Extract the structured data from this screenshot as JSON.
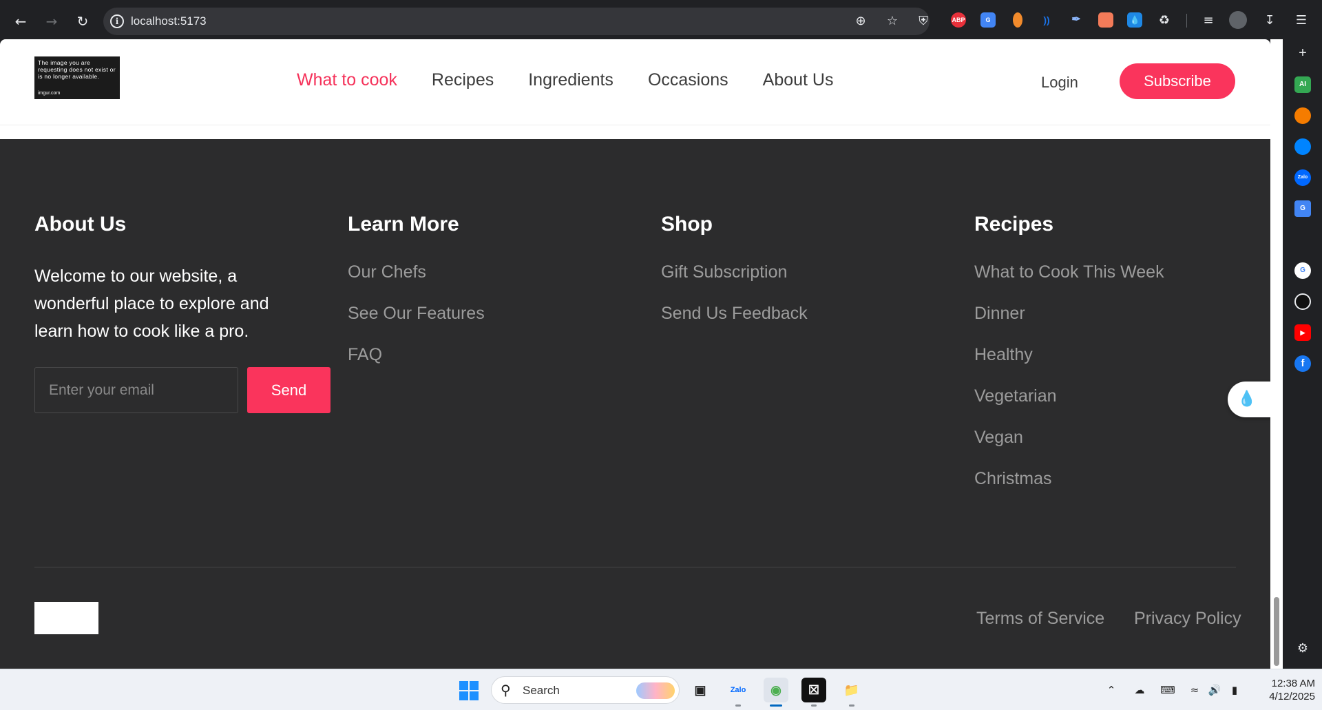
{
  "browser": {
    "url": "localhost:5173",
    "extensions": [
      {
        "name": "adblock-plus-icon",
        "label": "ABP",
        "color": "#e8313b"
      },
      {
        "name": "google-translate-icon",
        "label": "G",
        "color": "#4285f4"
      },
      {
        "name": "extension-orange-icon",
        "label": "",
        "color": "#f28b2c"
      },
      {
        "name": "extension-wave-icon",
        "label": "))",
        "color": "#1a73e8"
      },
      {
        "name": "eyedropper-icon",
        "label": "",
        "color": "#3b3b8f"
      },
      {
        "name": "extension-pattern-icon",
        "label": "",
        "color": "#f37b59"
      },
      {
        "name": "water-drop-icon",
        "label": "",
        "color": "#1e88e5"
      }
    ]
  },
  "header": {
    "logo": {
      "line1": "The image you are requesting does not exist or is no longer available.",
      "line2": "imgur.com"
    },
    "menu": [
      "What to cook",
      "Recipes",
      "Ingredients",
      "Occasions",
      "About Us"
    ],
    "active_menu_index": 0,
    "login": "Login",
    "subscribe": "Subscribe"
  },
  "footer": {
    "about": {
      "title": "About Us",
      "text": "Welcome to our website, a wonderful place to explore and learn how to cook like a pro.",
      "email_placeholder": "Enter your email",
      "send": "Send"
    },
    "learn_more": {
      "title": "Learn More",
      "links": [
        "Our Chefs",
        "See Our Features",
        "FAQ"
      ]
    },
    "shop": {
      "title": "Shop",
      "links": [
        "Gift Subscription",
        "Send Us Feedback"
      ]
    },
    "recipes": {
      "title": "Recipes",
      "links": [
        "What to Cook This Week",
        "Dinner",
        "Healthy",
        "Vegetarian",
        "Vegan",
        "Christmas"
      ]
    },
    "terms": "Terms of Service",
    "privacy": "Privacy Policy"
  },
  "sidepanel": [
    {
      "name": "copilot-ai-icon",
      "label": "AI",
      "color": "#34a853"
    },
    {
      "name": "firefox-like-icon",
      "label": "",
      "color": "#f57c00"
    },
    {
      "name": "messenger-icon",
      "label": "",
      "color": "#0084ff"
    },
    {
      "name": "zalo-icon",
      "label": "Zalo",
      "color": "#0068ff"
    },
    {
      "name": "translate-icon",
      "label": "G",
      "color": "#4285f4"
    },
    {
      "name": "google-icon",
      "label": "G",
      "color": "#ffffff"
    },
    {
      "name": "chatgpt-icon",
      "label": "",
      "color": "#111111"
    },
    {
      "name": "youtube-icon",
      "label": "▶",
      "color": "#ff0000"
    },
    {
      "name": "facebook-icon",
      "label": "f",
      "color": "#1877f2"
    }
  ],
  "taskbar": {
    "search": "Search",
    "apps": [
      {
        "name": "task-view-icon",
        "label": ""
      },
      {
        "name": "zalo-app-icon",
        "label": "Zalo"
      },
      {
        "name": "browser-app-icon",
        "label": ""
      },
      {
        "name": "capcut-app-icon",
        "label": ""
      },
      {
        "name": "file-explorer-icon",
        "label": ""
      }
    ],
    "time": "12:38 AM",
    "date": "4/12/2025"
  }
}
